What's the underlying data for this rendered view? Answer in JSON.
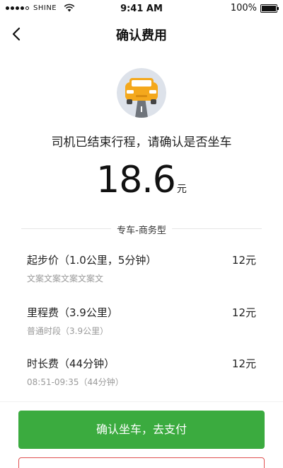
{
  "status_bar": {
    "carrier": "SHINE",
    "time": "9:41 AM",
    "battery": "100%",
    "battery_level": 1.0
  },
  "nav": {
    "title": "确认费用"
  },
  "trip": {
    "message": "司机已结束行程，请确认是否坐车",
    "fare_amount": "18.6",
    "fare_unit": "元",
    "service_type": "专车-商务型"
  },
  "fare_items": [
    {
      "name": "起步价（1.0公里，5分钟）",
      "price": "12元",
      "sub": "文案文案文案文案文"
    },
    {
      "name": "里程费（3.9公里）",
      "price": "12元",
      "sub": "普通时段（3.9公里）"
    },
    {
      "name": "时长费（44分钟）",
      "price": "12元",
      "sub": "08:51-09:35（44分钟）"
    }
  ],
  "actions": {
    "confirm_label": "确认坐车，去支付"
  },
  "colors": {
    "primary": "#3bab3f",
    "car_body": "#f4a81c",
    "danger_border": "#e05050"
  }
}
